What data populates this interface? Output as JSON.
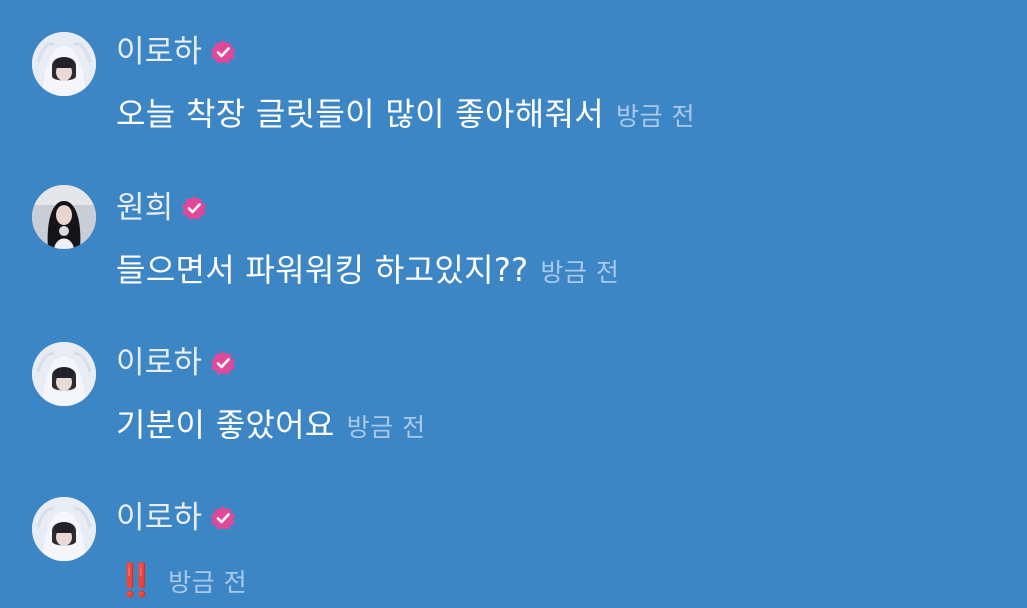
{
  "messages": [
    {
      "name": "이로하",
      "text": "오늘 착장 글릿들이 많이 좋아해줘서",
      "time": "방금 전",
      "avatar": "iroha-avatar-icon"
    },
    {
      "name": "원희",
      "text": "들으면서 파워워킹 하고있지??",
      "time": "방금 전",
      "avatar": "wonhee-avatar-icon"
    },
    {
      "name": "이로하",
      "text": "기분이 좋았어요",
      "time": "방금 전",
      "avatar": "iroha-avatar-icon"
    },
    {
      "name": "이로하",
      "text": "‼️",
      "time": "방금 전",
      "avatar": "iroha-avatar-icon"
    }
  ],
  "colors": {
    "background": "#3d86c6",
    "verified_badge": "#e0489a",
    "timestamp": "#a9c9ea"
  }
}
